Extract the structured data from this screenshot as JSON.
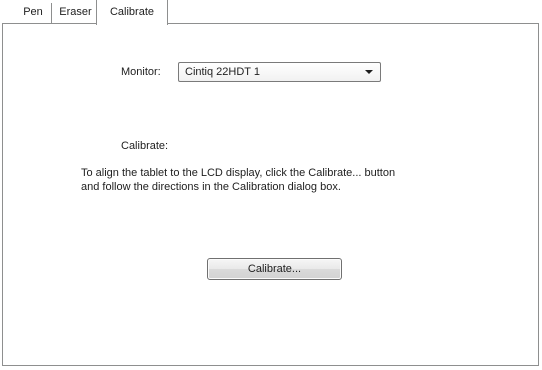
{
  "tabs": [
    {
      "label": "Pen",
      "active": false
    },
    {
      "label": "Eraser",
      "active": false
    },
    {
      "label": "Calibrate",
      "active": true
    }
  ],
  "monitor": {
    "label": "Monitor:",
    "selected": "Cintiq 22HDT 1",
    "arrow_icon": "chevron-down-icon"
  },
  "calibrate_section": {
    "heading": "Calibrate:",
    "instructions_line1": "To align the tablet to the LCD display, click the Calibrate... button",
    "instructions_line2": "and follow the directions in the Calibration dialog box."
  },
  "calibrate_button": {
    "label": "Calibrate..."
  },
  "colors": {
    "border": "#8e8f8f",
    "background": "#ffffff",
    "text": "#1e1e1e"
  }
}
